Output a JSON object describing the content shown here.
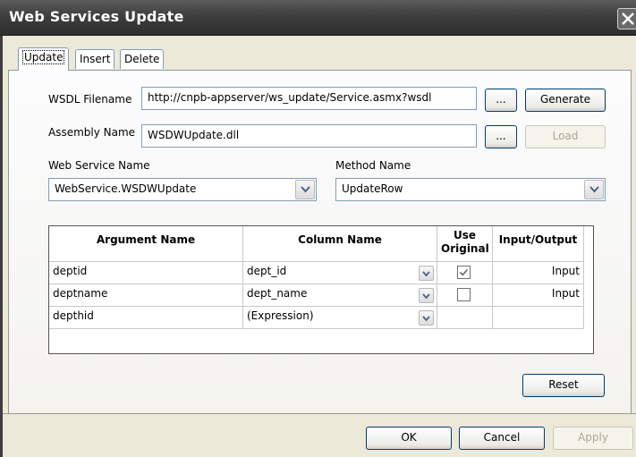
{
  "window": {
    "title": "Web Services Update"
  },
  "tabs": [
    {
      "label": "Update",
      "active": true
    },
    {
      "label": "Insert",
      "active": false
    },
    {
      "label": "Delete",
      "active": false
    }
  ],
  "form": {
    "wsdl_label": "WSDL Filename",
    "wsdl_value": "http://cnpb-appserver/ws_update/Service.asmx?wsdl",
    "browse_label": "...",
    "generate_label": "Generate",
    "assembly_label": "Assembly Name",
    "assembly_value": "WSDWUpdate.dll",
    "load_label": "Load",
    "web_service_label": "Web Service Name",
    "web_service_value": "WebService.WSDWUpdate",
    "method_label": "Method Name",
    "method_value": "UpdateRow"
  },
  "grid": {
    "headers": {
      "argument": "Argument Name",
      "column": "Column Name",
      "use_original_1": "Use",
      "use_original_2": "Original",
      "io": "Input/Output"
    },
    "rows": [
      {
        "argument": "deptid",
        "column": "dept_id",
        "use_original": true,
        "io": "Input"
      },
      {
        "argument": "deptname",
        "column": "dept_name",
        "use_original": false,
        "io": "Input"
      },
      {
        "argument": "depthid",
        "column": "(Expression)",
        "use_original": null,
        "io": ""
      }
    ]
  },
  "buttons": {
    "reset": "Reset",
    "ok": "OK",
    "cancel": "Cancel",
    "apply": "Apply"
  },
  "icons": {
    "close": "close-icon",
    "dropdown": "chevron-down-icon",
    "check": "check-icon"
  },
  "colors": {
    "titlebar": "#3e3e3e",
    "field_border": "#7f9db9",
    "dialog_bg": "#ece9d8"
  }
}
